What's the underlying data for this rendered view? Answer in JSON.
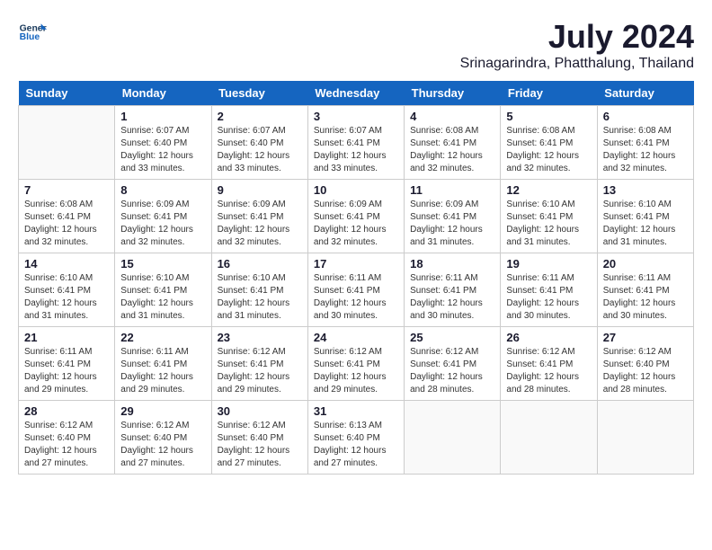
{
  "logo": {
    "line1": "General",
    "line2": "Blue"
  },
  "title": "July 2024",
  "subtitle": "Srinagarindra, Phatthalung, Thailand",
  "days_of_week": [
    "Sunday",
    "Monday",
    "Tuesday",
    "Wednesday",
    "Thursday",
    "Friday",
    "Saturday"
  ],
  "weeks": [
    [
      {
        "day": "",
        "sunrise": "",
        "sunset": "",
        "daylight": ""
      },
      {
        "day": "1",
        "sunrise": "Sunrise: 6:07 AM",
        "sunset": "Sunset: 6:40 PM",
        "daylight": "Daylight: 12 hours and 33 minutes."
      },
      {
        "day": "2",
        "sunrise": "Sunrise: 6:07 AM",
        "sunset": "Sunset: 6:40 PM",
        "daylight": "Daylight: 12 hours and 33 minutes."
      },
      {
        "day": "3",
        "sunrise": "Sunrise: 6:07 AM",
        "sunset": "Sunset: 6:41 PM",
        "daylight": "Daylight: 12 hours and 33 minutes."
      },
      {
        "day": "4",
        "sunrise": "Sunrise: 6:08 AM",
        "sunset": "Sunset: 6:41 PM",
        "daylight": "Daylight: 12 hours and 32 minutes."
      },
      {
        "day": "5",
        "sunrise": "Sunrise: 6:08 AM",
        "sunset": "Sunset: 6:41 PM",
        "daylight": "Daylight: 12 hours and 32 minutes."
      },
      {
        "day": "6",
        "sunrise": "Sunrise: 6:08 AM",
        "sunset": "Sunset: 6:41 PM",
        "daylight": "Daylight: 12 hours and 32 minutes."
      }
    ],
    [
      {
        "day": "7",
        "sunrise": "Sunrise: 6:08 AM",
        "sunset": "Sunset: 6:41 PM",
        "daylight": "Daylight: 12 hours and 32 minutes."
      },
      {
        "day": "8",
        "sunrise": "Sunrise: 6:09 AM",
        "sunset": "Sunset: 6:41 PM",
        "daylight": "Daylight: 12 hours and 32 minutes."
      },
      {
        "day": "9",
        "sunrise": "Sunrise: 6:09 AM",
        "sunset": "Sunset: 6:41 PM",
        "daylight": "Daylight: 12 hours and 32 minutes."
      },
      {
        "day": "10",
        "sunrise": "Sunrise: 6:09 AM",
        "sunset": "Sunset: 6:41 PM",
        "daylight": "Daylight: 12 hours and 32 minutes."
      },
      {
        "day": "11",
        "sunrise": "Sunrise: 6:09 AM",
        "sunset": "Sunset: 6:41 PM",
        "daylight": "Daylight: 12 hours and 31 minutes."
      },
      {
        "day": "12",
        "sunrise": "Sunrise: 6:10 AM",
        "sunset": "Sunset: 6:41 PM",
        "daylight": "Daylight: 12 hours and 31 minutes."
      },
      {
        "day": "13",
        "sunrise": "Sunrise: 6:10 AM",
        "sunset": "Sunset: 6:41 PM",
        "daylight": "Daylight: 12 hours and 31 minutes."
      }
    ],
    [
      {
        "day": "14",
        "sunrise": "Sunrise: 6:10 AM",
        "sunset": "Sunset: 6:41 PM",
        "daylight": "Daylight: 12 hours and 31 minutes."
      },
      {
        "day": "15",
        "sunrise": "Sunrise: 6:10 AM",
        "sunset": "Sunset: 6:41 PM",
        "daylight": "Daylight: 12 hours and 31 minutes."
      },
      {
        "day": "16",
        "sunrise": "Sunrise: 6:10 AM",
        "sunset": "Sunset: 6:41 PM",
        "daylight": "Daylight: 12 hours and 31 minutes."
      },
      {
        "day": "17",
        "sunrise": "Sunrise: 6:11 AM",
        "sunset": "Sunset: 6:41 PM",
        "daylight": "Daylight: 12 hours and 30 minutes."
      },
      {
        "day": "18",
        "sunrise": "Sunrise: 6:11 AM",
        "sunset": "Sunset: 6:41 PM",
        "daylight": "Daylight: 12 hours and 30 minutes."
      },
      {
        "day": "19",
        "sunrise": "Sunrise: 6:11 AM",
        "sunset": "Sunset: 6:41 PM",
        "daylight": "Daylight: 12 hours and 30 minutes."
      },
      {
        "day": "20",
        "sunrise": "Sunrise: 6:11 AM",
        "sunset": "Sunset: 6:41 PM",
        "daylight": "Daylight: 12 hours and 30 minutes."
      }
    ],
    [
      {
        "day": "21",
        "sunrise": "Sunrise: 6:11 AM",
        "sunset": "Sunset: 6:41 PM",
        "daylight": "Daylight: 12 hours and 29 minutes."
      },
      {
        "day": "22",
        "sunrise": "Sunrise: 6:11 AM",
        "sunset": "Sunset: 6:41 PM",
        "daylight": "Daylight: 12 hours and 29 minutes."
      },
      {
        "day": "23",
        "sunrise": "Sunrise: 6:12 AM",
        "sunset": "Sunset: 6:41 PM",
        "daylight": "Daylight: 12 hours and 29 minutes."
      },
      {
        "day": "24",
        "sunrise": "Sunrise: 6:12 AM",
        "sunset": "Sunset: 6:41 PM",
        "daylight": "Daylight: 12 hours and 29 minutes."
      },
      {
        "day": "25",
        "sunrise": "Sunrise: 6:12 AM",
        "sunset": "Sunset: 6:41 PM",
        "daylight": "Daylight: 12 hours and 28 minutes."
      },
      {
        "day": "26",
        "sunrise": "Sunrise: 6:12 AM",
        "sunset": "Sunset: 6:41 PM",
        "daylight": "Daylight: 12 hours and 28 minutes."
      },
      {
        "day": "27",
        "sunrise": "Sunrise: 6:12 AM",
        "sunset": "Sunset: 6:40 PM",
        "daylight": "Daylight: 12 hours and 28 minutes."
      }
    ],
    [
      {
        "day": "28",
        "sunrise": "Sunrise: 6:12 AM",
        "sunset": "Sunset: 6:40 PM",
        "daylight": "Daylight: 12 hours and 27 minutes."
      },
      {
        "day": "29",
        "sunrise": "Sunrise: 6:12 AM",
        "sunset": "Sunset: 6:40 PM",
        "daylight": "Daylight: 12 hours and 27 minutes."
      },
      {
        "day": "30",
        "sunrise": "Sunrise: 6:12 AM",
        "sunset": "Sunset: 6:40 PM",
        "daylight": "Daylight: 12 hours and 27 minutes."
      },
      {
        "day": "31",
        "sunrise": "Sunrise: 6:13 AM",
        "sunset": "Sunset: 6:40 PM",
        "daylight": "Daylight: 12 hours and 27 minutes."
      },
      {
        "day": "",
        "sunrise": "",
        "sunset": "",
        "daylight": ""
      },
      {
        "day": "",
        "sunrise": "",
        "sunset": "",
        "daylight": ""
      },
      {
        "day": "",
        "sunrise": "",
        "sunset": "",
        "daylight": ""
      }
    ]
  ]
}
